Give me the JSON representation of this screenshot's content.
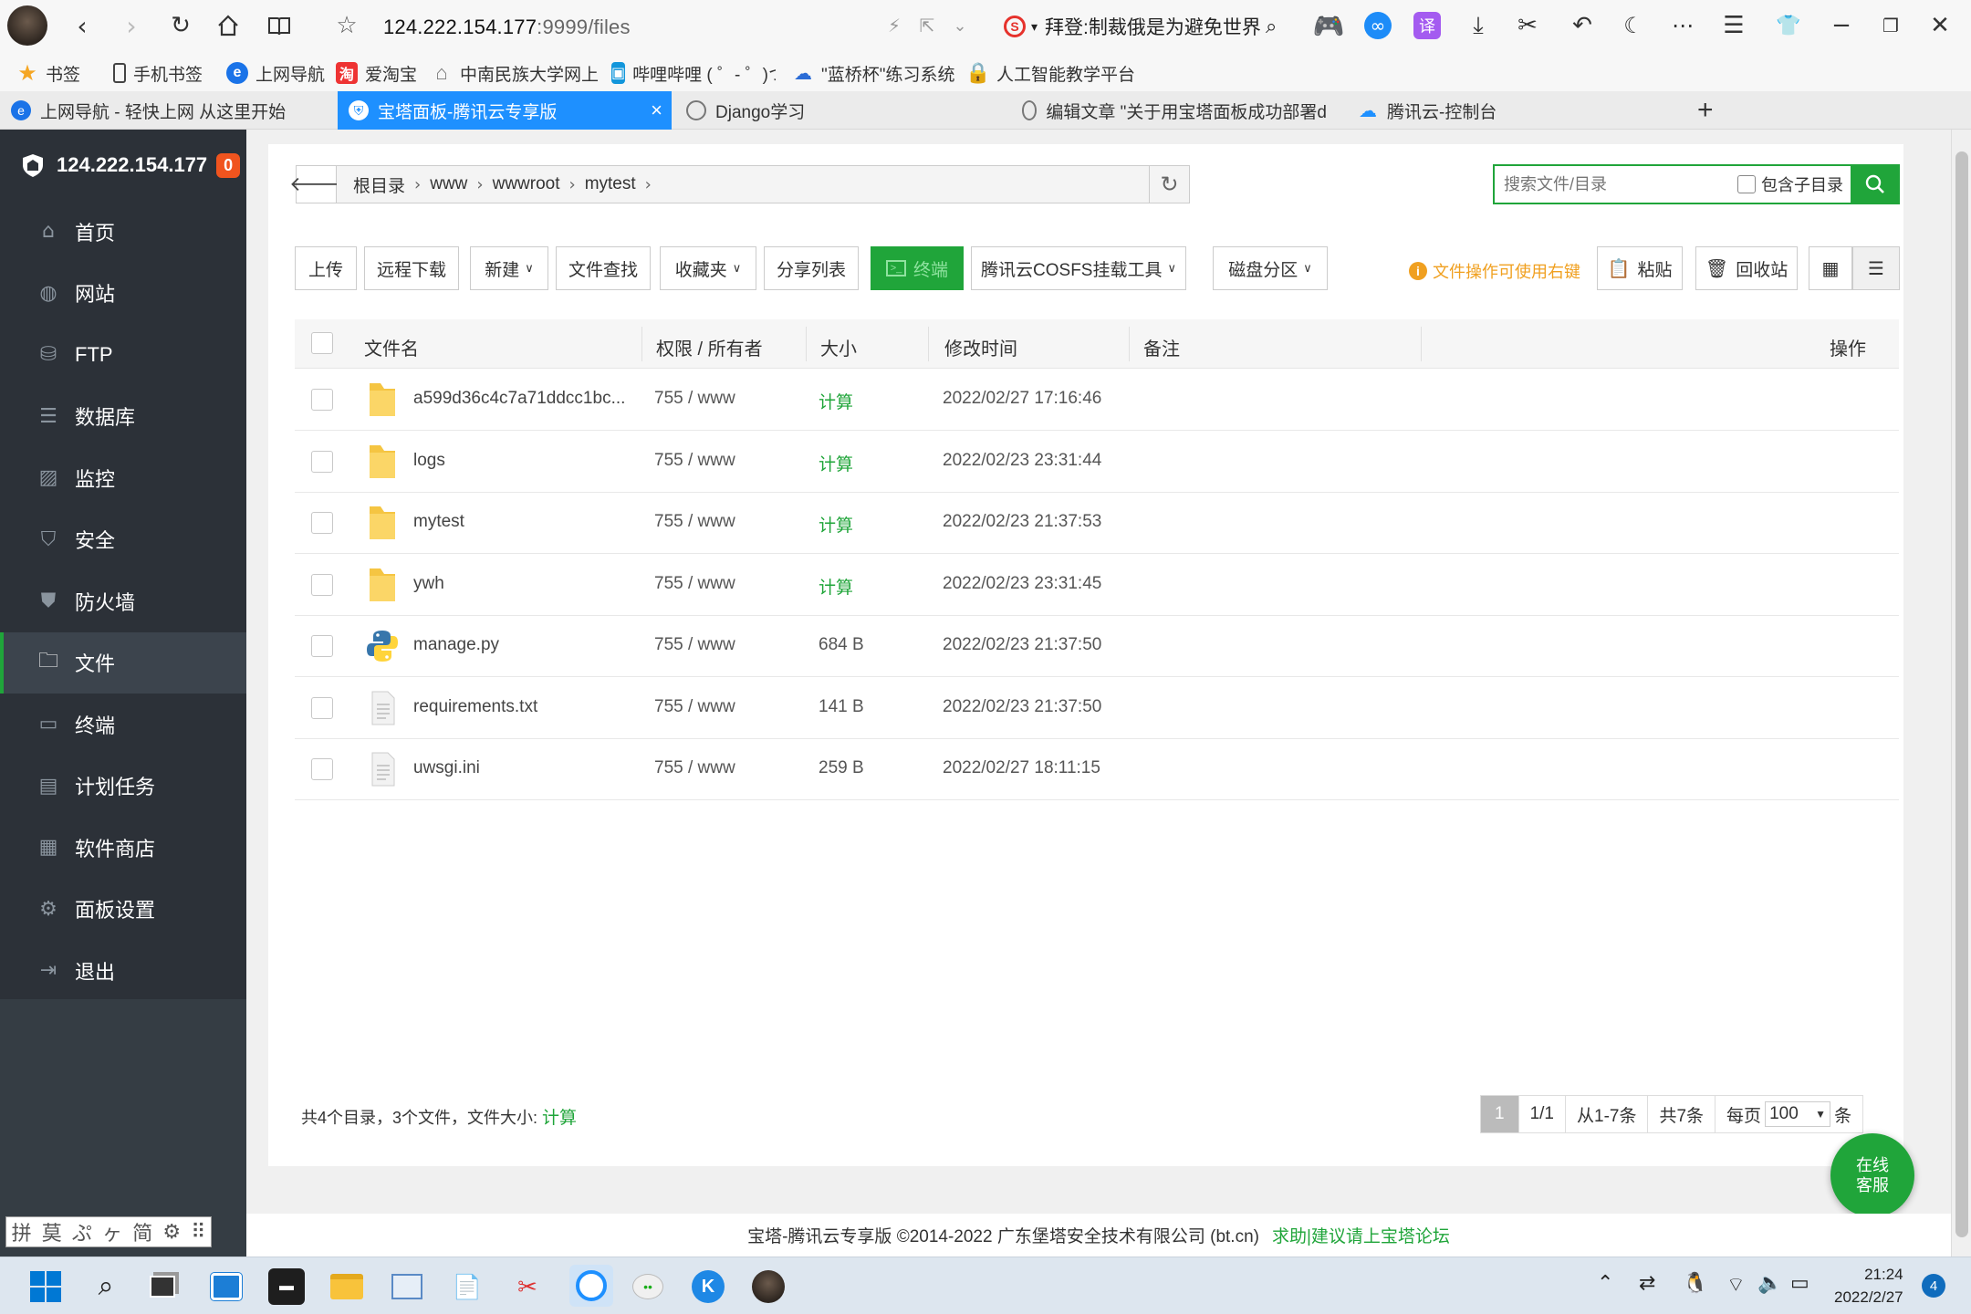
{
  "browser": {
    "url_main": "124.222.154.177",
    "url_rest": ":9999/files",
    "search_text": "拜登:制裁俄是为避免世界大",
    "bookmarks": [
      {
        "label": "书签"
      },
      {
        "label": "手机书签"
      },
      {
        "label": "上网导航"
      },
      {
        "label": "爱淘宝"
      },
      {
        "label": "中南民族大学网上"
      },
      {
        "label": "哔哩哔哩 ( ゜- ゜)つ"
      },
      {
        "label": "\"蓝桥杯\"练习系统"
      },
      {
        "label": "人工智能教学平台"
      }
    ],
    "tabs": [
      {
        "label": "上网导航 - 轻快上网 从这里开始"
      },
      {
        "label": "宝塔面板-腾讯云专享版"
      },
      {
        "label": "Django学习"
      },
      {
        "label": "编辑文章 \"关于用宝塔面板成功部署d"
      },
      {
        "label": "腾讯云-控制台"
      }
    ]
  },
  "sidebar": {
    "ip": "124.222.154.177",
    "badge": "0",
    "items": [
      {
        "label": "首页",
        "icon": "home-icon"
      },
      {
        "label": "网站",
        "icon": "globe-icon"
      },
      {
        "label": "FTP",
        "icon": "ftp-icon"
      },
      {
        "label": "数据库",
        "icon": "database-icon"
      },
      {
        "label": "监控",
        "icon": "monitor-icon"
      },
      {
        "label": "安全",
        "icon": "shield-icon"
      },
      {
        "label": "防火墙",
        "icon": "firewall-icon"
      },
      {
        "label": "文件",
        "icon": "folder-icon"
      },
      {
        "label": "终端",
        "icon": "terminal-icon"
      },
      {
        "label": "计划任务",
        "icon": "calendar-icon"
      },
      {
        "label": "软件商店",
        "icon": "apps-icon"
      },
      {
        "label": "面板设置",
        "icon": "gear-icon"
      },
      {
        "label": "退出",
        "icon": "logout-icon"
      }
    ],
    "active_index": 7
  },
  "files": {
    "breadcrumb": [
      "根目录",
      "www",
      "wwwroot",
      "mytest"
    ],
    "search_placeholder": "搜索文件/目录",
    "include_sub_label": "包含子目录",
    "buttons": {
      "upload": "上传",
      "remote_download": "远程下载",
      "new": "新建",
      "file_search": "文件查找",
      "favorites": "收藏夹",
      "share_list": "分享列表",
      "terminal": "终端",
      "cosfs": "腾讯云COSFS挂载工具",
      "disk": "磁盘分区",
      "paste": "粘贴",
      "recycle": "回收站"
    },
    "tip": "文件操作可使用右键",
    "columns": {
      "name": "文件名",
      "perm": "权限 / 所有者",
      "size": "大小",
      "mtime": "修改时间",
      "note": "备注",
      "ops": "操作"
    },
    "rows": [
      {
        "name": "a599d36c4c7a71ddcc1bc...",
        "type": "folder",
        "perm": "755 / www",
        "size": "计算",
        "mtime": "2022/02/27 17:16:46"
      },
      {
        "name": "logs",
        "type": "folder",
        "perm": "755 / www",
        "size": "计算",
        "mtime": "2022/02/23 23:31:44"
      },
      {
        "name": "mytest",
        "type": "folder",
        "perm": "755 / www",
        "size": "计算",
        "mtime": "2022/02/23 21:37:53"
      },
      {
        "name": "ywh",
        "type": "folder",
        "perm": "755 / www",
        "size": "计算",
        "mtime": "2022/02/23 23:31:45"
      },
      {
        "name": "manage.py",
        "type": "python",
        "perm": "755 / www",
        "size": "684 B",
        "mtime": "2022/02/23 21:37:50"
      },
      {
        "name": "requirements.txt",
        "type": "text",
        "perm": "755 / www",
        "size": "141 B",
        "mtime": "2022/02/23 21:37:50"
      },
      {
        "name": "uwsgi.ini",
        "type": "text",
        "perm": "755 / www",
        "size": "259 B",
        "mtime": "2022/02/27 18:11:15"
      }
    ],
    "summary_prefix": "共4个目录，3个文件，文件大小:",
    "summary_calc": "计算",
    "pager": {
      "current": "1",
      "pages": "1/1",
      "range": "从1-7条",
      "total": "共7条",
      "per_page_label": "每页",
      "per_page": "100",
      "unit": "条"
    }
  },
  "online_service": {
    "line1": "在线",
    "line2": "客服"
  },
  "copyright": {
    "text": "宝塔-腾讯云专享版 ©2014-2022 广东堡塔安全技术有限公司 (bt.cn)",
    "link": "求助|建议请上宝塔论坛"
  },
  "taskbar": {
    "time": "21:24",
    "date": "2022/2/27",
    "notifications": "4"
  },
  "ime": [
    "拼",
    "莫",
    "ぷ",
    "ヶ",
    "简",
    "⚙",
    "⠿"
  ]
}
